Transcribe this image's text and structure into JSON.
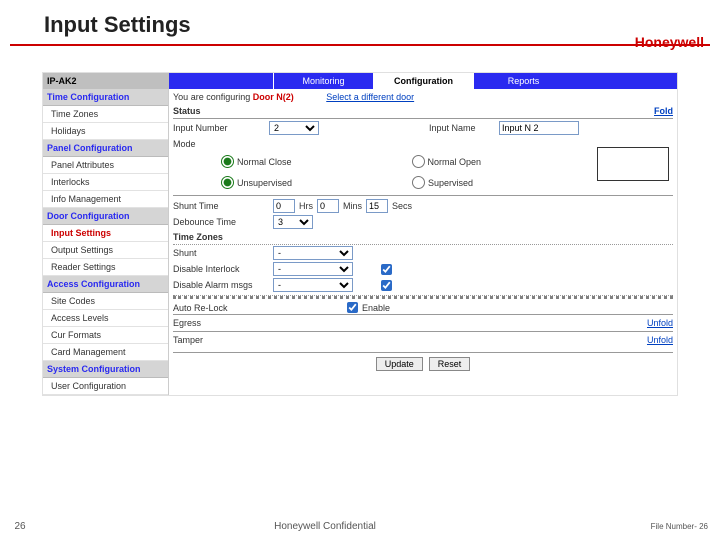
{
  "slide": {
    "title": "Input Settings",
    "brand": "Honeywell"
  },
  "tabs": {
    "device": "IP-AK2",
    "monitoring": "Monitoring",
    "configuration": "Configuration",
    "reports": "Reports"
  },
  "sidebar": {
    "groups": [
      {
        "title": "Time Configuration",
        "items": [
          "Time Zones",
          "Holidays"
        ]
      },
      {
        "title": "Panel Configuration",
        "items": [
          "Panel Attributes",
          "Interlocks",
          "Info Management"
        ]
      },
      {
        "title": "Door Configuration",
        "items": [
          "Input Settings",
          "Output Settings",
          "Reader Settings"
        ]
      },
      {
        "title": "Access Configuration",
        "items": [
          "Site Codes",
          "Access Levels",
          "Cur Formats",
          "Card Management"
        ]
      },
      {
        "title": "System Configuration",
        "items": [
          "User Configuration"
        ]
      }
    ]
  },
  "main": {
    "configuring_prefix": "You are configuring ",
    "configuring_door": "Door N(2)",
    "select_different": "Select a different door",
    "status": "Status",
    "fold": "Fold",
    "input_number_lbl": "Input Number",
    "input_number_val": "2",
    "input_name_lbl": "Input Name",
    "input_name_val": "Input N 2",
    "mode_lbl": "Mode",
    "mode_nc": "Normal Close",
    "mode_no": "Normal Open",
    "mode_unsup": "Unsupervised",
    "mode_sup": "Supervised",
    "shunt_time_lbl": "Shunt Time",
    "shunt_hr": "0",
    "hrs_lbl": "Hrs",
    "shunt_min": "0",
    "mins_lbl": "Mins",
    "shunt_sec": "15",
    "secs_lbl": "Secs",
    "debounce_lbl": "Debounce Time",
    "debounce_val": "3",
    "timezone_hd": "Time Zones",
    "tz_shunt": "Shunt",
    "tz_disable_interlock": "Disable Interlock",
    "tz_disable_alarm": "Disable Alarm msgs",
    "auto_relock_lbl": "Auto Re-Lock",
    "enable_lbl": "Enable",
    "egress_lbl": "Egress",
    "tamper_lbl": "Tamper",
    "unfold": "Unfold",
    "update": "Update",
    "reset": "Reset"
  },
  "footer": {
    "page": "26",
    "confidential": "Honeywell Confidential",
    "filenum": "File Number- 26"
  }
}
